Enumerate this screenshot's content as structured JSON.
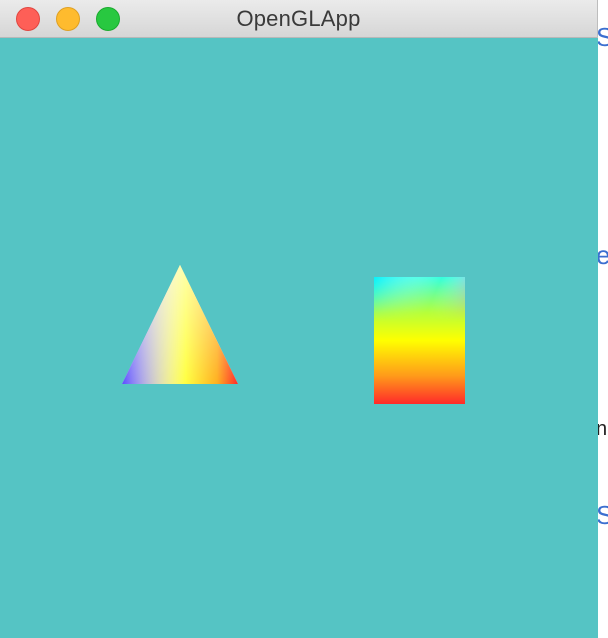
{
  "window": {
    "title": "OpenGLApp",
    "background_color": "#55c4c4"
  },
  "titlebar": {
    "buttons": [
      {
        "name": "close",
        "color": "#fe5f57"
      },
      {
        "name": "minimize",
        "color": "#febb2e"
      },
      {
        "name": "zoom",
        "color": "#28c840"
      }
    ]
  },
  "scene": {
    "triangle": {
      "vertex_colors": [
        "#ffffff",
        "#5a4cff",
        "#ff2a2a"
      ],
      "mid_color": "#ffff00"
    },
    "rectangle": {
      "gradient_colors": [
        "#00f0ff",
        "#ff3bd9",
        "#a6ff33",
        "#ffff00",
        "#ff9a1a",
        "#ff2a2a"
      ]
    }
  },
  "background_window_edge": {
    "glyphs": [
      "S",
      "e",
      "n",
      "S"
    ]
  }
}
